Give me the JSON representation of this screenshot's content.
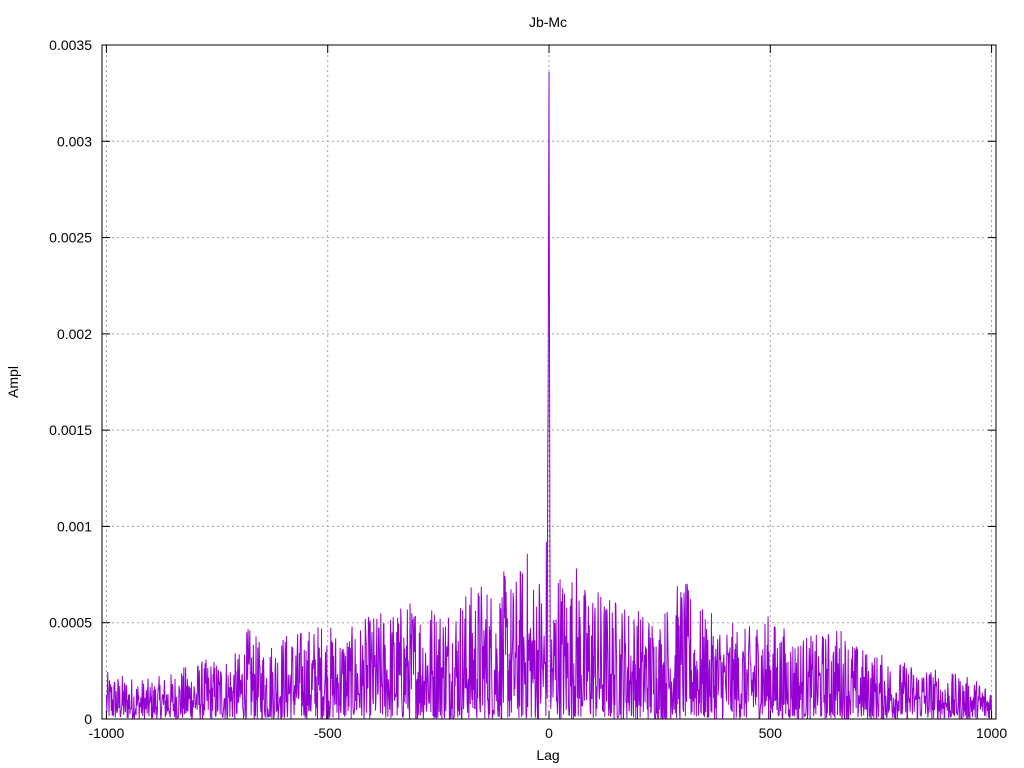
{
  "chart_data": {
    "type": "line",
    "title": "Jb-Mc",
    "xlabel": "Lag",
    "ylabel": "Ampl",
    "xlim": [
      -1010,
      1010
    ],
    "ylim": [
      0,
      0.0035
    ],
    "xticks": [
      -1000,
      -500,
      0,
      500,
      1000
    ],
    "xtick_labels": [
      "-1000",
      "-500",
      "0",
      "500",
      "1000"
    ],
    "yticks": [
      0,
      0.0005,
      0.001,
      0.0015,
      0.002,
      0.0025,
      0.003,
      0.0035
    ],
    "ytick_labels": [
      "0",
      "0.0005",
      "0.001",
      "0.0015",
      "0.002",
      "0.0025",
      "0.003",
      "0.0035"
    ],
    "grid": true,
    "color": "#9400d3",
    "series": [
      {
        "values_note": "Noisy cross-correlation amplitude vs lag; peak at lag 0",
        "x": [
          -1000,
          -950,
          -900,
          -850,
          -800,
          -750,
          -700,
          -680,
          -650,
          -600,
          -550,
          -510,
          -500,
          -450,
          -400,
          -350,
          -300,
          -250,
          -200,
          -180,
          -150,
          -120,
          -100,
          -80,
          -60,
          -50,
          -40,
          -20,
          -10,
          -5,
          -2,
          0,
          2,
          5,
          10,
          20,
          40,
          60,
          80,
          100,
          120,
          150,
          200,
          250,
          300,
          350,
          400,
          450,
          480,
          500,
          550,
          600,
          650,
          660,
          700,
          750,
          800,
          850,
          900,
          950,
          1000
        ],
        "y": [
          0.00026,
          0.00024,
          0.00022,
          0.00026,
          0.00032,
          0.00034,
          0.00037,
          0.00051,
          0.00042,
          0.00048,
          0.0005,
          0.00055,
          0.00052,
          0.0005,
          0.00058,
          0.00062,
          0.00068,
          0.00065,
          0.0007,
          0.00074,
          0.00078,
          0.00074,
          0.00082,
          0.00076,
          0.00088,
          0.00096,
          0.0008,
          0.00086,
          0.0007,
          0.0012,
          0.00165,
          0.00336,
          0.0009,
          0.00062,
          0.00072,
          0.00088,
          0.00078,
          0.00089,
          0.00074,
          0.00078,
          0.0007,
          0.00068,
          0.00062,
          0.00058,
          0.00079,
          0.0006,
          0.00054,
          0.0005,
          0.00062,
          0.00056,
          0.00048,
          0.00046,
          0.00051,
          0.00052,
          0.0004,
          0.00036,
          0.00032,
          0.0003,
          0.00026,
          0.00023,
          0.0002
        ]
      }
    ]
  }
}
